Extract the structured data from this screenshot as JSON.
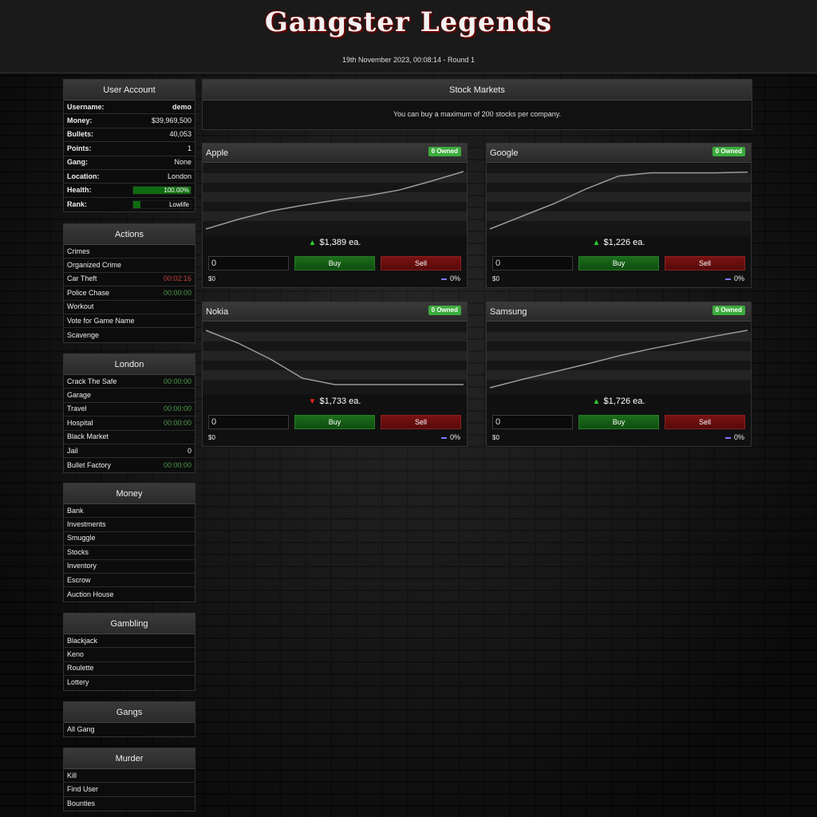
{
  "header": {
    "logo_text": "Gangster Legends",
    "dateline": "19th November 2023, 00:08:14 - Round 1"
  },
  "user_account": {
    "title": "User Account",
    "username_label": "Username:",
    "username": "demo",
    "money_label": "Money:",
    "money": "$39,969,500",
    "bullets_label": "Bullets:",
    "bullets": "40,053",
    "points_label": "Points:",
    "points": "1",
    "gang_label": "Gang:",
    "gang": "None",
    "location_label": "Location:",
    "location": "London",
    "health_label": "Health:",
    "health": "100.00%",
    "health_fraction": 1.0,
    "rank_label": "Rank:",
    "rank": "Lowlife",
    "rank_fraction": 0.12
  },
  "actions": {
    "title": "Actions",
    "items": [
      {
        "label": "Crimes",
        "timer": ""
      },
      {
        "label": "Organized Crime",
        "timer": ""
      },
      {
        "label": "Car Theft",
        "timer": "00:02:16"
      },
      {
        "label": "Police Chase",
        "timer": "00:00:00"
      },
      {
        "label": "Workout",
        "timer": ""
      },
      {
        "label": "Vote for Game Name",
        "timer": ""
      },
      {
        "label": "Scavenge",
        "timer": ""
      }
    ]
  },
  "london": {
    "title": "London",
    "items": [
      {
        "label": "Crack The Safe",
        "timer": "00:00:00"
      },
      {
        "label": "Garage",
        "timer": ""
      },
      {
        "label": "Travel",
        "timer": "00:00:00"
      },
      {
        "label": "Hospital",
        "timer": "00:00:00"
      },
      {
        "label": "Black Market",
        "timer": ""
      },
      {
        "label": "Jail",
        "timer": "0"
      },
      {
        "label": "Bullet Factory",
        "timer": "00:00:00"
      }
    ]
  },
  "money_menu": {
    "title": "Money",
    "items": [
      "Bank",
      "Investments",
      "Smuggle",
      "Stocks",
      "Inventory",
      "Escrow",
      "Auction House"
    ]
  },
  "gambling": {
    "title": "Gambling",
    "items": [
      "Blackjack",
      "Keno",
      "Roulette",
      "Lottery"
    ]
  },
  "gangs": {
    "title": "Gangs",
    "items": [
      "All Gang"
    ]
  },
  "murder": {
    "title": "Murder",
    "items": [
      "Kill",
      "Find User",
      "Bounties"
    ]
  },
  "stock_markets": {
    "title": "Stock Markets",
    "note": "You can buy a maximum of 200 stocks per company."
  },
  "stocks": [
    {
      "name": "Apple",
      "owned": "0 Owned",
      "trend": "up",
      "price": "$1,389 ea.",
      "qty": "0",
      "buy": "Buy",
      "sell": "Sell",
      "cost": "$0",
      "change": "0%",
      "line_color": "#9a9a9a",
      "history": [
        0.05,
        0.2,
        0.33,
        0.42,
        0.5,
        0.57,
        0.66,
        0.8,
        0.95
      ]
    },
    {
      "name": "Google",
      "owned": "0 Owned",
      "trend": "up",
      "price": "$1,226 ea.",
      "qty": "0",
      "buy": "Buy",
      "sell": "Sell",
      "cost": "$0",
      "change": "0%",
      "line_color": "#9a9a9a",
      "history": [
        0.05,
        0.25,
        0.45,
        0.68,
        0.88,
        0.93,
        0.93,
        0.93,
        0.94
      ]
    },
    {
      "name": "Nokia",
      "owned": "0 Owned",
      "trend": "down",
      "price": "$1,733 ea.",
      "qty": "0",
      "buy": "Buy",
      "sell": "Sell",
      "cost": "$0",
      "change": "0%",
      "line_color": "#9a9a9a",
      "history": [
        0.95,
        0.75,
        0.5,
        0.2,
        0.1,
        0.1,
        0.1,
        0.1,
        0.1
      ]
    },
    {
      "name": "Samsung",
      "owned": "0 Owned",
      "trend": "up",
      "price": "$1,726 ea.",
      "qty": "0",
      "buy": "Buy",
      "sell": "Sell",
      "cost": "$0",
      "change": "0%",
      "line_color": "#9a9a9a",
      "history": [
        0.05,
        0.18,
        0.3,
        0.42,
        0.55,
        0.66,
        0.76,
        0.86,
        0.95
      ]
    }
  ]
}
